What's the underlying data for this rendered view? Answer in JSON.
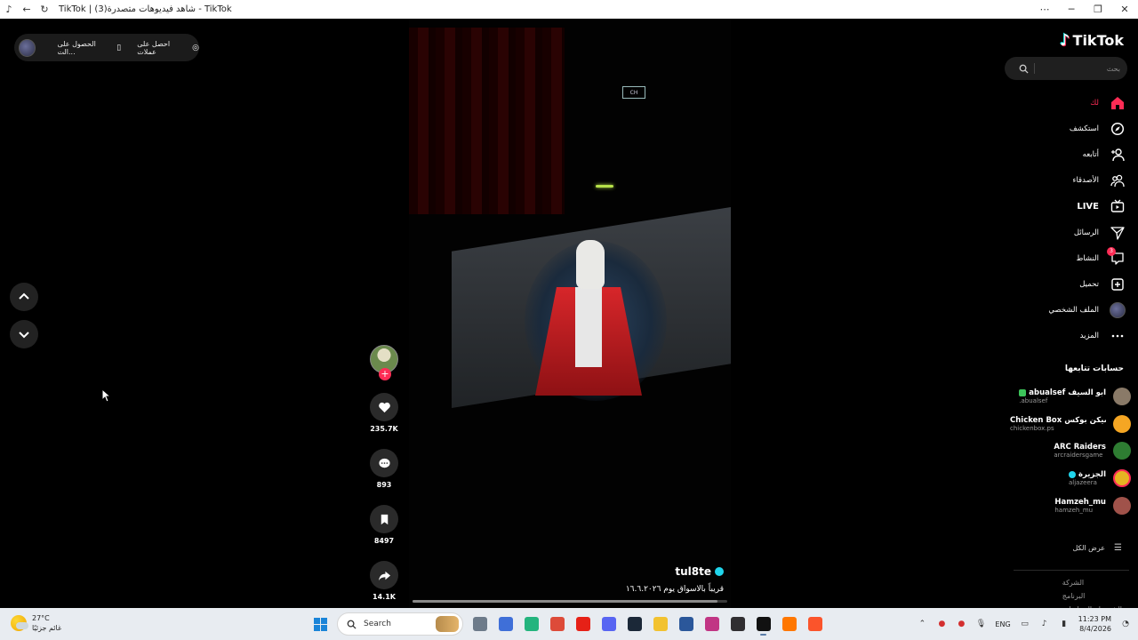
{
  "browser": {
    "title": "TikTok | شاهد فيديوهات متصدرة(3) - TikTok"
  },
  "top_pill": {
    "get_coins": "احصل على عملات",
    "get_app": "الحصول على الت..."
  },
  "video": {
    "author": "tul8te",
    "description": "قريباً بالاسواق يوم ١٦.٦.٢٠٢٦",
    "screen_logo": "CH",
    "progress": 0.97
  },
  "actions": {
    "likes": "235.7K",
    "comments": "893",
    "saves": "8497",
    "shares": "14.1K",
    "follow_plus": "+"
  },
  "sidebar": {
    "logo": "TikTok",
    "search_placeholder": "بحث",
    "menu": [
      {
        "label": "لك",
        "icon": "home-icon",
        "active": true
      },
      {
        "label": "استكشف",
        "icon": "compass-icon"
      },
      {
        "label": "أتابعه",
        "icon": "user-follow-icon"
      },
      {
        "label": "الأصدقاء",
        "icon": "friends-icon"
      },
      {
        "label": "LIVE",
        "icon": "live-tv-icon"
      },
      {
        "label": "الرسائل",
        "icon": "send-icon"
      },
      {
        "label": "النشاط",
        "icon": "activity-icon",
        "badge": "3"
      },
      {
        "label": "تحميل",
        "icon": "upload-icon"
      },
      {
        "label": "الملف الشخصي",
        "icon": "profile-avatar-icon"
      },
      {
        "label": "المزيد",
        "icon": "more-icon"
      }
    ],
    "following_title": "حسابات تتابعها",
    "following": [
      {
        "name": "ابو السيف abualsef",
        "handle": "abualsef.",
        "color": "#8a7a68",
        "badge": "green"
      },
      {
        "name": "تشيكن بوكس Chicken Box",
        "handle": "chickenbox.ps",
        "color": "#f5a623"
      },
      {
        "name": "ARC Raiders",
        "handle": "arcraidersgame",
        "color": "#2e7d32"
      },
      {
        "name": "الجزيرة",
        "handle": "aljazeera",
        "color": "#e6b422",
        "badge": "blue"
      },
      {
        "name": "Hamzeh_mu",
        "handle": "hamzeh_mu",
        "color": "#a0524a"
      }
    ],
    "see_all": "عرض الكل",
    "footer": [
      "الشركة",
      "البرنامج",
      "الشروط والسياسات"
    ]
  },
  "taskbar": {
    "temperature": "27°C",
    "weather_text": "غائم جزئيًا",
    "search_label": "Search",
    "language": "ENG",
    "time": "11:23 PM",
    "date": "8/4/2026",
    "apps": [
      {
        "name": "start-button",
        "color": "#1a84d8"
      },
      {
        "name": "file-explorer-grey",
        "color": "#6d7b8a"
      },
      {
        "name": "store-icon",
        "color": "#3f6fd8"
      },
      {
        "name": "app-green",
        "color": "#24b47e"
      },
      {
        "name": "chrome-icon",
        "color": "#dd4b39"
      },
      {
        "name": "youtube-icon",
        "color": "#e62117"
      },
      {
        "name": "discord-icon",
        "color": "#5865f2"
      },
      {
        "name": "steam-icon",
        "color": "#1b2838"
      },
      {
        "name": "folder-icon",
        "color": "#f2c230"
      },
      {
        "name": "word-like-icon",
        "color": "#2b579a"
      },
      {
        "name": "instagram-icon",
        "color": "#c13584"
      },
      {
        "name": "obs-like-icon",
        "color": "#302e31"
      },
      {
        "name": "tiktok-icon",
        "color": "#111111"
      },
      {
        "name": "soundcloud-icon",
        "color": "#ff7700"
      },
      {
        "name": "brave-icon",
        "color": "#fb542b"
      }
    ]
  }
}
